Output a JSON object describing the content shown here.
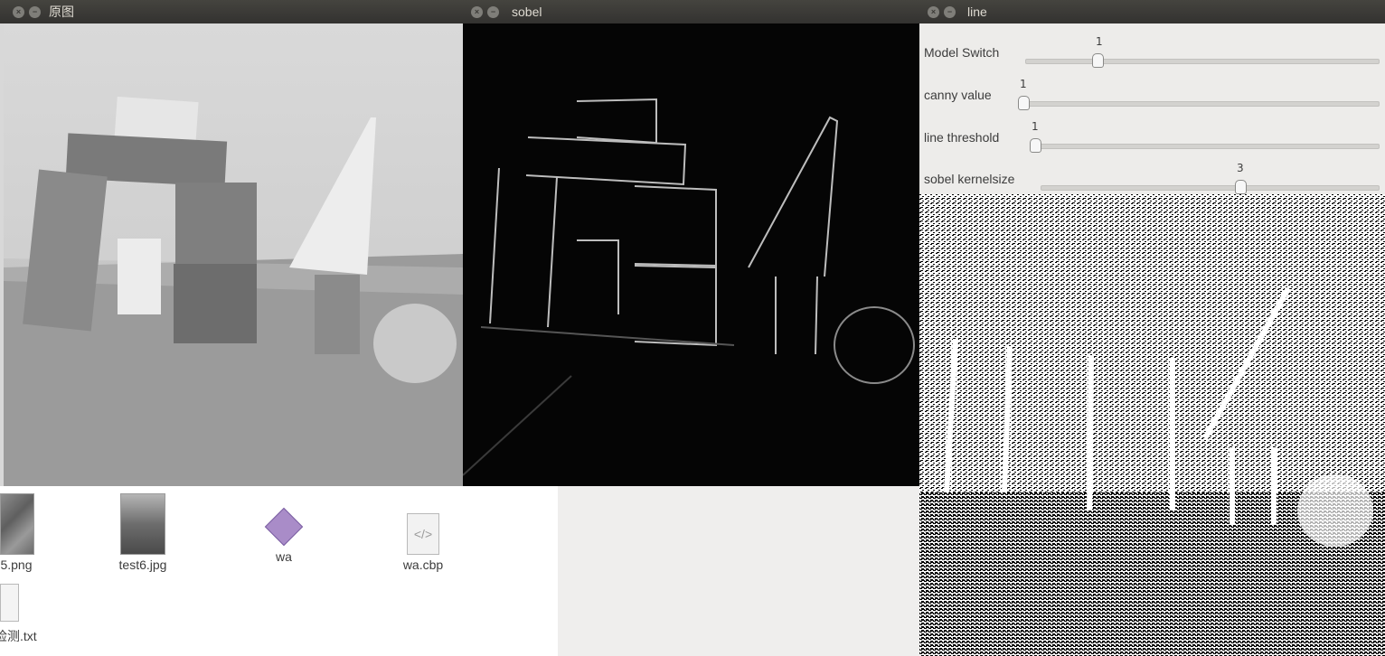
{
  "windows": {
    "original": {
      "title": "原图"
    },
    "sobel": {
      "title": "sobel"
    },
    "line": {
      "title": "line"
    }
  },
  "trackbars": [
    {
      "label": "Model Switch",
      "value": "1",
      "level": 0.2
    },
    {
      "label": "canny value",
      "value": "1",
      "level": 0.0
    },
    {
      "label": "line threshold",
      "value": "1",
      "level": 0.0
    },
    {
      "label": "sobel kernelsize",
      "value": "3",
      "level": 0.6
    }
  ],
  "files": [
    {
      "name": "5.png",
      "icon": "image-thumbnail-icon"
    },
    {
      "name": "test6.jpg",
      "icon": "image-thumbnail-icon"
    },
    {
      "name": "wa",
      "icon": "executable-icon"
    },
    {
      "name": "wa.cbp",
      "icon": "code-file-icon"
    },
    {
      "name": "线检测.txt",
      "icon": "text-file-icon"
    }
  ],
  "colors": {
    "titlebar": "#3b3a36",
    "panel": "#edecea"
  }
}
